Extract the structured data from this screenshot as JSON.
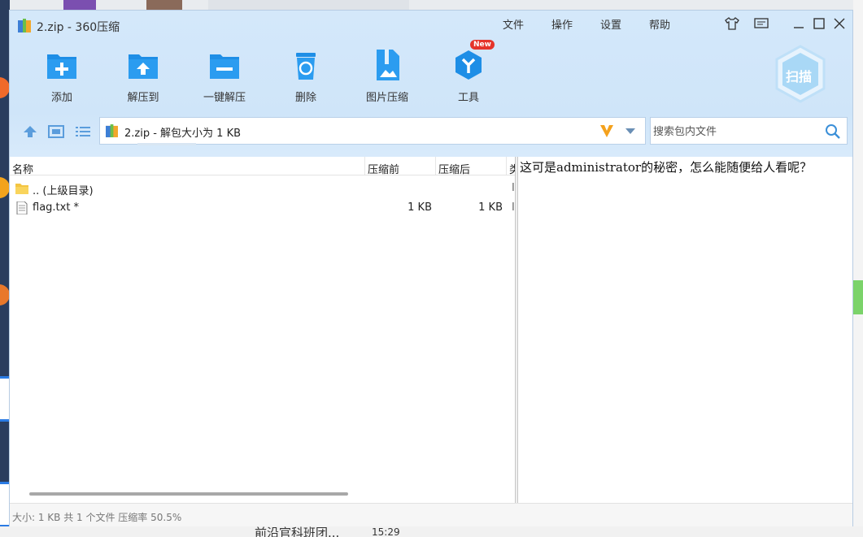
{
  "window": {
    "title": "2.zip - 360压缩",
    "menu": [
      "文件",
      "操作",
      "设置",
      "帮助"
    ]
  },
  "toolbar": {
    "items": [
      {
        "label": "添加",
        "icon": "add-icon"
      },
      {
        "label": "解压到",
        "icon": "extract-to-icon"
      },
      {
        "label": "一键解压",
        "icon": "one-click-extract-icon"
      },
      {
        "label": "删除",
        "icon": "delete-icon"
      },
      {
        "label": "图片压缩",
        "icon": "image-compress-icon"
      },
      {
        "label": "工具",
        "icon": "tools-icon"
      }
    ],
    "new_badge": "New",
    "scan_label": "扫描"
  },
  "pathbar": {
    "text": "2.zip - 解包大小为 1 KB"
  },
  "search": {
    "placeholder": "搜索包内文件"
  },
  "list": {
    "columns": [
      "名称",
      "压缩前",
      "压缩后",
      "类"
    ],
    "rows": [
      {
        "name": ".. (上级目录)",
        "before": "",
        "after": "",
        "type": "I",
        "icon": "folder-icon"
      },
      {
        "name": "flag.txt *",
        "before": "1 KB",
        "after": "1 KB",
        "type": "I",
        "icon": "text-file-icon"
      }
    ]
  },
  "preview": {
    "text": "这可是administrator的秘密，怎么能随便给人看呢？"
  },
  "status": {
    "text": "大小: 1 KB 共 1 个文件 压缩率 50.5%"
  },
  "background": {
    "bottom_texts": [
      "前沿官科班团...",
      "15:29"
    ],
    "colors": {
      "accent": "#1e8ee6",
      "header": "#d4e8fa",
      "badge": "#e5342a"
    }
  }
}
